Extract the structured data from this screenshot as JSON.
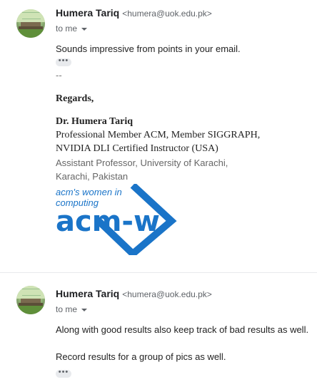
{
  "messages": [
    {
      "sender_name": "Humera Tariq",
      "sender_email": "<humera@uok.edu.pk>",
      "to_label": "to me",
      "body": [
        "Sounds impressive from points in your email."
      ],
      "dots": "•••",
      "signature_separator": "--",
      "signature": {
        "regards": "Regards,",
        "name": "Dr. Humera Tariq",
        "line1": "Professional Member ACM, Member SIGGRAPH,",
        "line2": "NVIDIA DLI Certified Instructor (USA)",
        "line3": "Assistant Professor, University of Karachi,",
        "line4": "Karachi, Pakistan"
      },
      "logo": {
        "tagline1": "acm's women in",
        "tagline2": "computing",
        "wordmark": "acm-w",
        "color": "#1a74c8"
      }
    },
    {
      "sender_name": "Humera Tariq",
      "sender_email": "<humera@uok.edu.pk>",
      "to_label": "to me",
      "body": [
        "Along with good results also keep track of bad results as well.",
        "Record results for a group of pics as well."
      ],
      "dots": "•••"
    }
  ]
}
